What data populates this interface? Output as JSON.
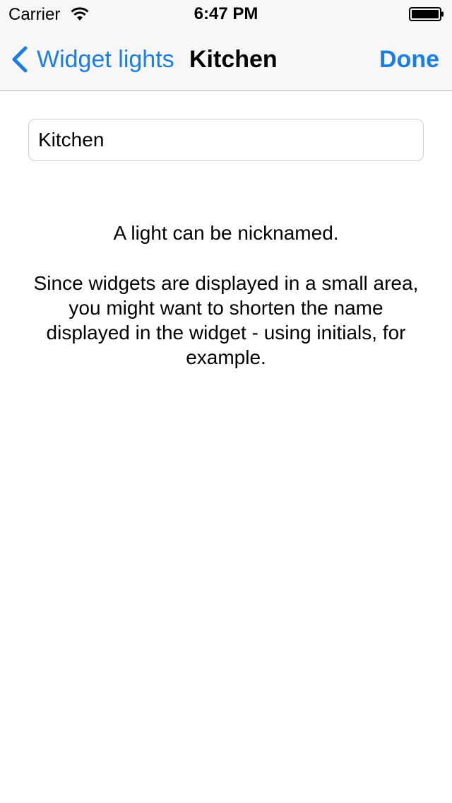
{
  "status_bar": {
    "carrier": "Carrier",
    "time": "6:47 PM",
    "wifi_icon": "wifi-icon",
    "battery_icon": "battery-icon"
  },
  "nav_bar": {
    "back_label": "Widget lights",
    "back_icon": "chevron-left-icon",
    "title": "Kitchen",
    "done_label": "Done"
  },
  "name_field": {
    "value": "Kitchen",
    "placeholder": ""
  },
  "info": {
    "line1": "A light can be nicknamed.",
    "line2": "Since widgets are displayed in a small area, you might want to shorten the name displayed in the widget - using initials, for example."
  },
  "colors": {
    "accent": "#1a7de8",
    "bar_background": "#f7f7f8",
    "separator": "#b2b2b2"
  }
}
